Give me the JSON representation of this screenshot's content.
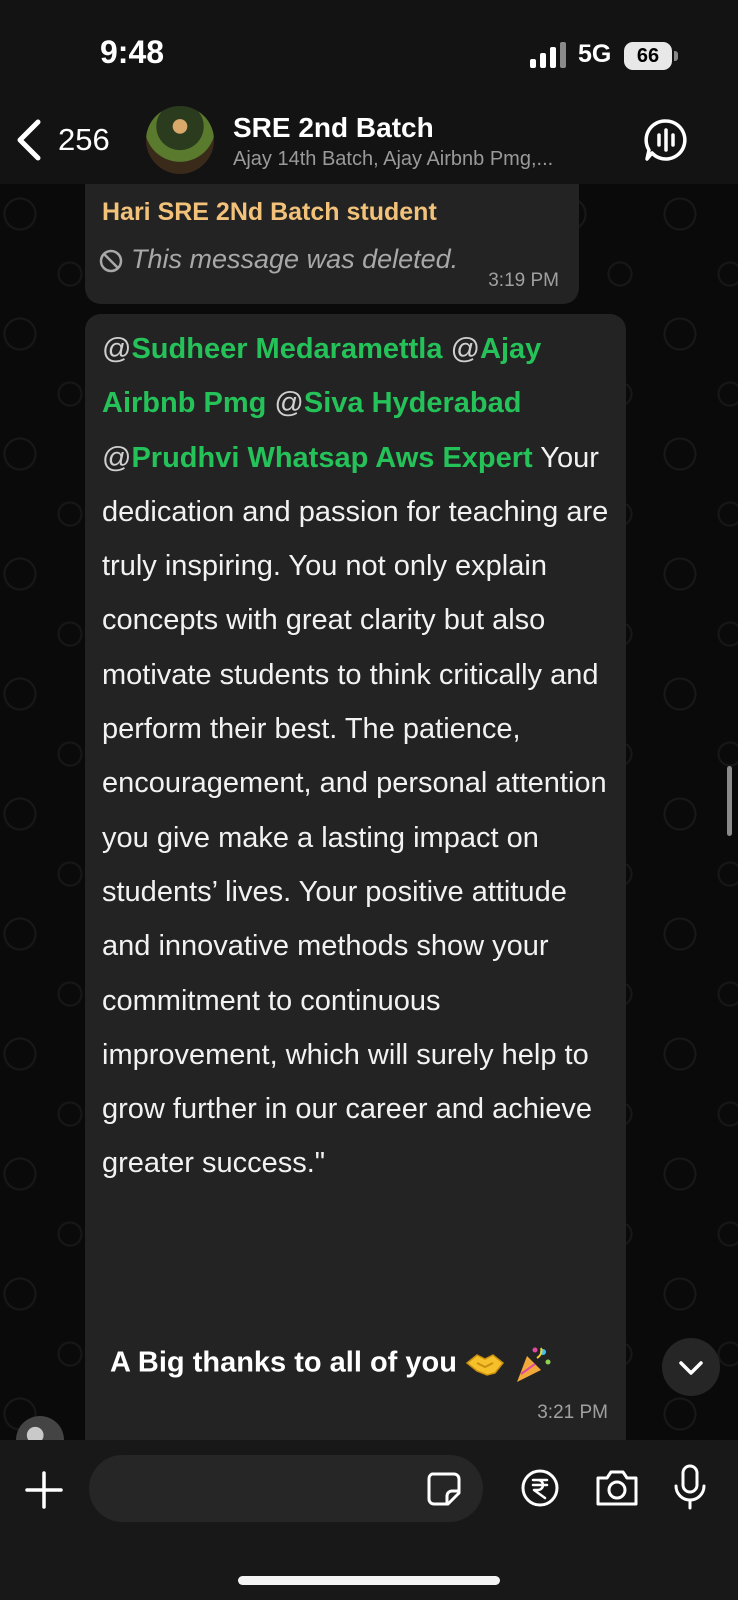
{
  "status": {
    "time": "9:48",
    "network": "5G",
    "battery": "66"
  },
  "header": {
    "back_count": "256",
    "title": "SRE 2nd Batch",
    "subtitle": "Ajay 14th Batch, Ajay Airbnb Pmg,..."
  },
  "messages": [
    {
      "sender": "Hari SRE 2Nd Batch student",
      "text": "This message was deleted.",
      "time": "3:19 PM"
    },
    {
      "mentions": [
        "Sudheer Medaramettla",
        "Ajay Airbnb Pmg",
        "Siva Hyderabad",
        "Prudhvi Whatsap Aws Expert"
      ],
      "body": "Your dedication and passion for teaching are truly inspiring. You not only explain concepts with great clarity but also motivate students to think critically and perform their best. The patience, encouragement, and personal attention you give make a lasting impact on students’ lives. Your positive attitude and innovative methods show your commitment to continuous improvement, which will surely help to grow further in our career and achieve greater success.\"",
      "thanks": "A Big thanks to all of you",
      "time": "3:21 PM"
    }
  ],
  "composer": {
    "placeholder": ""
  },
  "colors": {
    "mention": "#25c25a",
    "sender": "#f3c27a",
    "bubble": "#232323",
    "background": "#0a0a0a"
  },
  "icons": [
    "chevron-left-icon",
    "group-avatar",
    "voice-chat-icon",
    "deleted-message-icon",
    "handshake-emoji",
    "party-popper-emoji",
    "chevron-down-icon",
    "plus-icon",
    "sticker-icon",
    "rupee-payment-icon",
    "camera-icon",
    "microphone-icon"
  ]
}
